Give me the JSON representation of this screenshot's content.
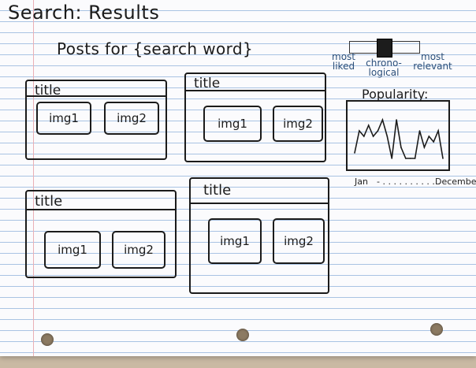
{
  "page": {
    "title": "Search: Results",
    "subtitle": "Posts for {search word}"
  },
  "sort_toggle": {
    "options": [
      "most liked",
      "chrono-logical",
      "most relevant"
    ],
    "selected_index": 1
  },
  "posts": [
    {
      "title": "title",
      "images": [
        "img1",
        "img2"
      ]
    },
    {
      "title": "title",
      "images": [
        "img1",
        "img2"
      ]
    },
    {
      "title": "title",
      "images": [
        "img1",
        "img2"
      ]
    },
    {
      "title": "title",
      "images": [
        "img1",
        "img2"
      ]
    }
  ],
  "popularity": {
    "title": "Popularity:",
    "x_start_label": "Jan",
    "x_end_label": "December",
    "x_dots": "- . . . . . . . . . . ."
  },
  "chart_data": {
    "type": "line",
    "title": "Popularity:",
    "xlabel": "",
    "ylabel": "",
    "x": [
      "Jan",
      "",
      "",
      "",
      "",
      "",
      "",
      "",
      "",
      "",
      "",
      "",
      "",
      "",
      "",
      "",
      "",
      "",
      "",
      "December"
    ],
    "series": [
      {
        "values": [
          2,
          6,
          5,
          7,
          5,
          6,
          8,
          5,
          1,
          8,
          3,
          1,
          1,
          1,
          6,
          3,
          5,
          4,
          6,
          1
        ]
      }
    ],
    "ylim": [
      0,
      10
    ],
    "grid": false
  }
}
